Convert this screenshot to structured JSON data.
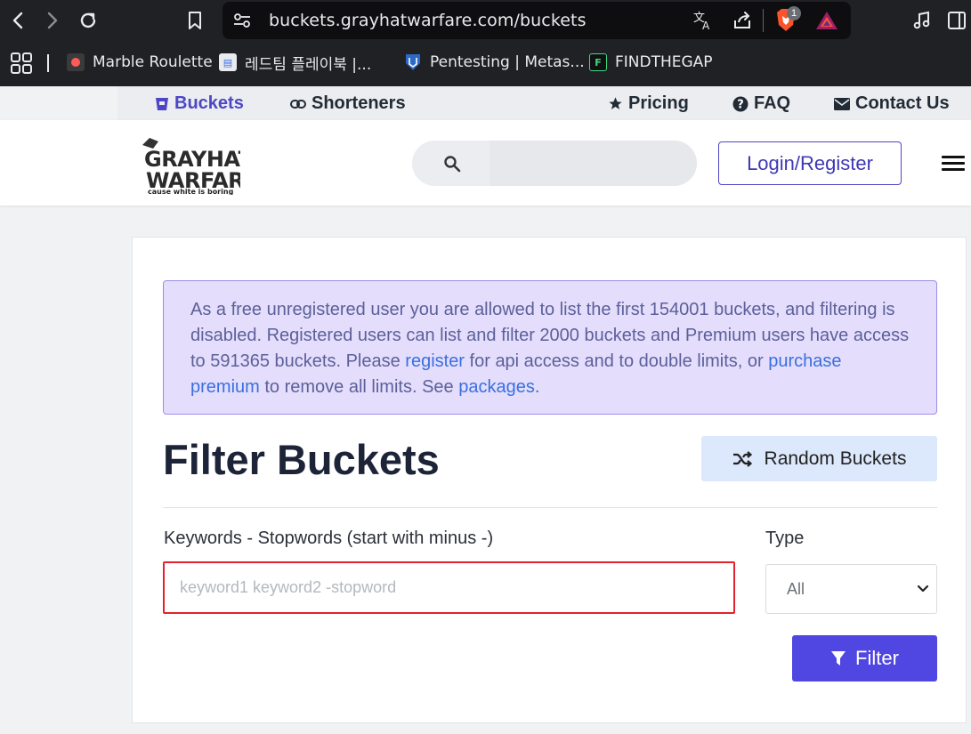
{
  "browser": {
    "url": "buckets.grayhatwarfare.com/buckets",
    "shield_badge_count": "1",
    "bookmarks": [
      {
        "label": "Marble Roulette"
      },
      {
        "label": "레드팀 플레이북 |..."
      },
      {
        "label": "Pentesting | Metas..."
      },
      {
        "label": "FINDTHEGAP"
      }
    ]
  },
  "topnav": {
    "buckets": "Buckets",
    "shorteners": "Shorteners",
    "pricing": "Pricing",
    "faq": "FAQ",
    "contact": "Contact Us"
  },
  "header": {
    "logo_line1": "GRAYHAT",
    "logo_line2": "WARFARE",
    "logo_tagline": "cause white is boring",
    "login_label": "Login/Register"
  },
  "notice": {
    "text1": "As a free unregistered user you are allowed to list the first 154001 buckets, and filtering is disabled. Registered users can list and filter 2000 buckets and Premium users have access to 591365 buckets. Please ",
    "link_register": "register",
    "text2": " for api access and to double limits, or ",
    "link_purchase": "purchase premium",
    "text3": " to remove all limits. See ",
    "link_packages": "packages",
    "text4": "."
  },
  "filter": {
    "heading": "Filter Buckets",
    "random_label": "Random Buckets",
    "keywords_label": "Keywords - Stopwords (start with minus -)",
    "keywords_placeholder": "keyword1 keyword2 -stopword",
    "keywords_value": "",
    "type_label": "Type",
    "type_selected": "All",
    "filter_label": "Filter"
  },
  "colors": {
    "accent": "#5046e1",
    "alert_bg": "#e4defc",
    "highlight_border": "#e0232e"
  }
}
